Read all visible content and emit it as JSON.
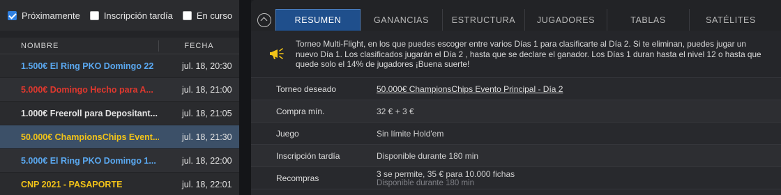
{
  "filters": [
    {
      "label": "Próximamente",
      "checked": true
    },
    {
      "label": "Inscripción tardía",
      "checked": false
    },
    {
      "label": "En curso",
      "checked": false
    }
  ],
  "table": {
    "headers": {
      "name": "NOMBRE",
      "date": "FECHA"
    },
    "rows": [
      {
        "name": "1.500€ El Ring PKO Domingo 22",
        "date": "jul. 18, 20:30",
        "color": "#5aa8f0"
      },
      {
        "name": "5.000€ Domingo Hecho para A...",
        "date": "jul. 18, 21:00",
        "color": "#e0382e"
      },
      {
        "name": "1.000€ Freeroll para Depositant...",
        "date": "jul. 18, 21:05",
        "color": "#e4e4e4"
      },
      {
        "name": "50.000€ ChampionsChips Event...",
        "date": "jul. 18, 21:30",
        "color": "#f2c318"
      },
      {
        "name": "5.000€ El Ring PKO Domingo 1...",
        "date": "jul. 18, 22:00",
        "color": "#5aa8f0"
      },
      {
        "name": "CNP 2021 - PASAPORTE",
        "date": "jul. 18, 22:01",
        "color": "#f2c318"
      }
    ],
    "selected_index": 3
  },
  "tabs": [
    "RESUMEN",
    "GANANCIAS",
    "ESTRUCTURA",
    "JUGADORES",
    "TABLAS",
    "SATÉLITES"
  ],
  "active_tab": 0,
  "notice": {
    "icon": "megaphone-icon",
    "text": "Torneo Multi-Flight, en los que puedes escoger entre varios Días 1 para clasificarte al Día 2. Si te eliminan, puedes jugar un nuevo Día 1. Los clasificados jugarán el Día 2 , hasta que se declare el ganador. Los Días 1 duran hasta el nivel 12 o hasta que quede solo el 14% de jugadores ¡Buena suerte!"
  },
  "details": [
    {
      "label": "Torneo deseado",
      "value": "50.000€ ChampionsChips Evento Principal - Día 2",
      "link": true
    },
    {
      "label": "Compra mín.",
      "value": "32 € + 3 €"
    },
    {
      "label": "Juego",
      "value": "Sin límite Hold'em"
    },
    {
      "label": "Inscripción tardía",
      "value": "Disponible durante 180 min"
    },
    {
      "label": "Recompras",
      "value": "3 se permite, 35 € para 10.000 fichas",
      "sub": "Disponible durante 180 min"
    }
  ],
  "colors": {
    "accent": "#1f4f8c",
    "selected_row": "#3c5068",
    "warning": "#f2c318"
  }
}
